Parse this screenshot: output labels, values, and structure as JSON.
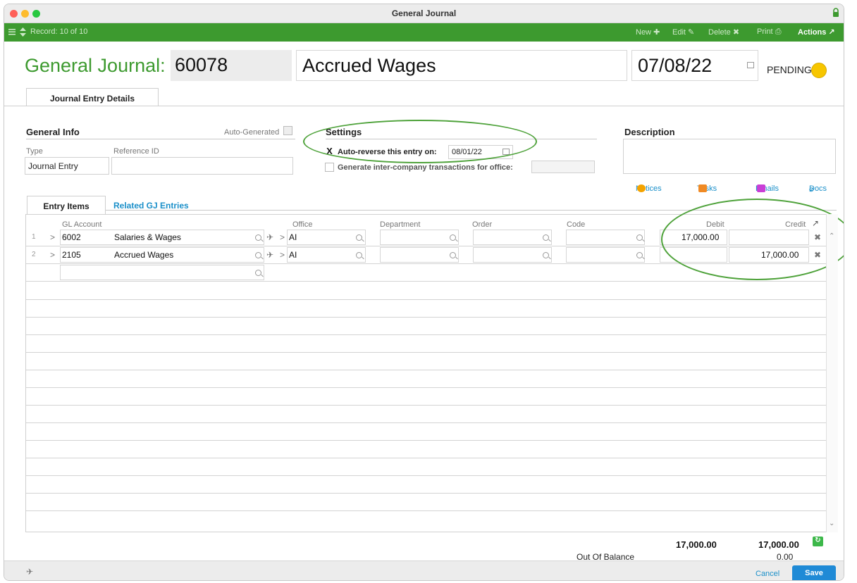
{
  "window": {
    "title": "General Journal"
  },
  "toolbar": {
    "record": "Record: 10 of 10",
    "new": "New",
    "edit": "Edit",
    "delete": "Delete",
    "print": "Print",
    "actions": "Actions"
  },
  "header": {
    "label": "General Journal:",
    "id": "60078",
    "name": "Accrued Wages",
    "date": "07/08/22",
    "status": "PENDING",
    "status_color": "#f7c600"
  },
  "tabs": {
    "main": "Journal Entry Details"
  },
  "links": {
    "notices": "Notices",
    "tasks": "Tasks",
    "emails": "Emails",
    "docs": "Docs"
  },
  "general_info": {
    "title": "General Info",
    "auto_generated": "Auto-Generated",
    "type_label": "Type",
    "type_value": "Journal Entry",
    "ref_label": "Reference ID",
    "ref_value": ""
  },
  "settings": {
    "title": "Settings",
    "auto_reverse_label": "Auto-reverse this entry on:",
    "auto_reverse_checked": "X",
    "auto_reverse_date": "08/01/22",
    "intercompany_label": "Generate inter-company transactions for office:"
  },
  "description": {
    "title": "Description",
    "value": ""
  },
  "grid": {
    "tab_items": "Entry Items",
    "tab_related": "Related GJ Entries",
    "columns": {
      "gl": "GL Account",
      "office": "Office",
      "department": "Department",
      "order": "Order",
      "code": "Code",
      "debit": "Debit",
      "credit": "Credit"
    },
    "rows": [
      {
        "num": "1",
        "arrow": ">",
        "account": "6002",
        "name": "Salaries & Wages",
        "office": "AI",
        "debit": "17,000.00",
        "credit": ""
      },
      {
        "num": "2",
        "arrow": ">",
        "account": "2105",
        "name": "Accrued Wages",
        "office": "AI",
        "debit": "",
        "credit": "17,000.00"
      }
    ]
  },
  "totals": {
    "debit": "17,000.00",
    "credit": "17,000.00",
    "out_of_balance_label": "Out Of Balance",
    "out_of_balance_value": "0.00"
  },
  "footer": {
    "cancel": "Cancel",
    "save": "Save"
  }
}
